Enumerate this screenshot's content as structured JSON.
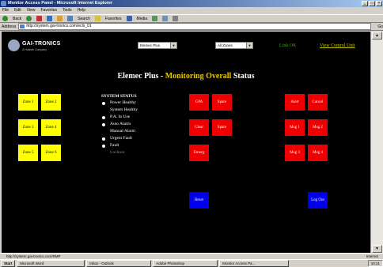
{
  "window": {
    "title": "Monitor Access Panel - Microsoft Internet Explorer",
    "controls": [
      "_",
      "□",
      "×"
    ]
  },
  "menubar": [
    "File",
    "Edit",
    "View",
    "Favorites",
    "Tools",
    "Help"
  ],
  "toolbar": {
    "back": "Back",
    "search": "Search",
    "favorites": "Favorites",
    "media": "Media"
  },
  "addressbar": {
    "label": "Address",
    "url": "http://system.gai-tronics.com/ecls_01",
    "go": "Go"
  },
  "page": {
    "logo": {
      "name": "GAI-TRONICS",
      "sub": "A Hubbell Company"
    },
    "selects": {
      "left": "Elemec Plus",
      "right": "All Zones"
    },
    "link_status": "Link OK",
    "view_control_unit": "View Control Unit",
    "heading": {
      "part1": "Elemec Plus - ",
      "part2": "Monitoring Overall",
      "part3": " Status"
    },
    "system_status": {
      "title": "SYSTEM STATUS",
      "rows": [
        {
          "label": "Power Healthy",
          "dot": true,
          "dim": false
        },
        {
          "label": "System Healthy",
          "dot": false,
          "dim": false
        },
        {
          "label": "P.A. In Use",
          "dot": true,
          "dim": false
        },
        {
          "label": "Auto Alarm",
          "dot": true,
          "dim": false
        },
        {
          "label": "Manual Alarm",
          "dot": false,
          "dim": false
        },
        {
          "label": "Urgent Fault",
          "dot": true,
          "dim": false
        },
        {
          "label": "Fault",
          "dot": true,
          "dim": false
        },
        {
          "label": "Lockout",
          "dot": false,
          "dim": true
        }
      ]
    },
    "zones": [
      "Zone 1",
      "Zone 2",
      "Zone 3",
      "Zone 4",
      "Zone 5",
      "Zone 6"
    ],
    "inputs": [
      "GPA",
      "Spare",
      "Clear",
      "Spare",
      "Emerg"
    ],
    "outputs": [
      "Alert",
      "Cancel",
      "Msg 1",
      "Msg 2",
      "Msg 3",
      "Msg 4"
    ],
    "buttons": {
      "left": "Reset",
      "right": "Log Out"
    }
  },
  "statusbar": {
    "text": "http://system.gai-tronics.com/RMP",
    "zone": "Internet"
  },
  "taskbar": {
    "start": "Start",
    "tasks": [
      "Microsoft Word",
      "Inbox - Outlook",
      "Adobe Photoshop",
      "Monitor Access Pa..."
    ],
    "clock": "10:21"
  },
  "colors": {
    "zone": "#ffff00",
    "alarm": "#ee0000",
    "action": "#0000ee",
    "link_ok": "#3aa400",
    "heading_accent": "#e8c800"
  }
}
